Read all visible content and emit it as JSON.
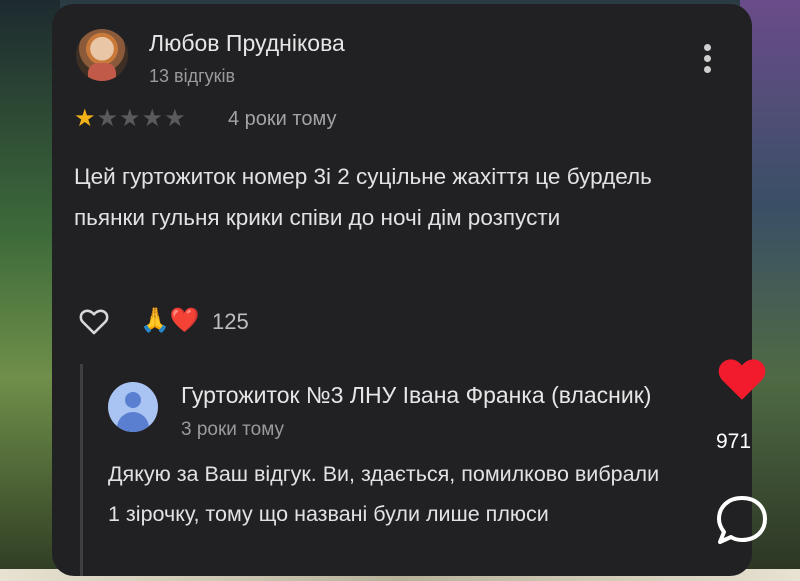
{
  "review": {
    "author_name": "Любов Пруднікова",
    "author_reviews": "13 відгуків",
    "rating": 1,
    "rating_max": 5,
    "time_ago": "4 роки тому",
    "text": "Цей гуртожиток номер 3і 2 суцільне жахіття це бурдель пьянки гульня крики співи до ночі дім розпусти",
    "reactions_emoji": "🙏❤️",
    "reactions_count": "125"
  },
  "owner_reply": {
    "owner_name": "Гуртожиток №3 ЛНУ Івана Франка (власник)",
    "time_ago": "3 роки тому",
    "text": "Дякую за Ваш відгук. Ви, здається, помилково вибрали 1 зірочку, тому що названі були лише плюси"
  },
  "overlay": {
    "like_count": "971"
  },
  "colors": {
    "card_bg": "#212124",
    "star_on": "#f2b319",
    "star_off": "#5a5a5d",
    "like_red": "#f21b2d"
  },
  "icons": [
    "more-vert-icon",
    "heart-outline-icon",
    "heart-filled-icon",
    "comment-bubble-icon",
    "owner-avatar-icon"
  ]
}
